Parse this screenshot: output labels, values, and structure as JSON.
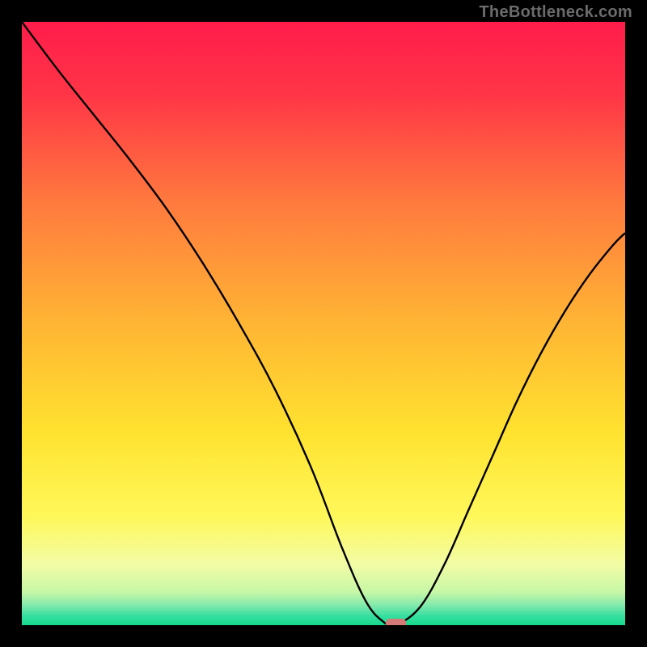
{
  "watermark": "TheBottleneck.com",
  "chart_data": {
    "type": "line",
    "title": "",
    "xlabel": "",
    "ylabel": "",
    "xlim": [
      0,
      100
    ],
    "ylim": [
      0,
      100
    ],
    "grid": false,
    "legend": false,
    "axes_visible": false,
    "background_gradient": {
      "stops": [
        {
          "offset": 0.0,
          "color": "#ff1c4b"
        },
        {
          "offset": 0.12,
          "color": "#ff3547"
        },
        {
          "offset": 0.3,
          "color": "#ff7a3e"
        },
        {
          "offset": 0.5,
          "color": "#ffb534"
        },
        {
          "offset": 0.68,
          "color": "#ffe22f"
        },
        {
          "offset": 0.82,
          "color": "#fff85a"
        },
        {
          "offset": 0.9,
          "color": "#f2fca6"
        },
        {
          "offset": 0.945,
          "color": "#c7f7a6"
        },
        {
          "offset": 0.965,
          "color": "#8aebad"
        },
        {
          "offset": 0.985,
          "color": "#35dfa0"
        },
        {
          "offset": 1.0,
          "color": "#17d98e"
        }
      ]
    },
    "series": [
      {
        "name": "bottleneck-curve",
        "color": "#000000",
        "x": [
          0,
          6,
          12,
          18,
          24,
          30,
          36,
          42,
          48,
          53,
          57,
          60,
          62,
          66,
          70,
          74,
          78,
          82,
          86,
          90,
          94,
          98,
          100
        ],
        "y": [
          100,
          92,
          84.5,
          77,
          69,
          60,
          50,
          39,
          26,
          13,
          4,
          0.5,
          0,
          3,
          10,
          19,
          28,
          37,
          45,
          52,
          58,
          63,
          65
        ]
      }
    ],
    "marker": {
      "name": "optimal-marker",
      "x": 62,
      "y": 0,
      "width_pct": 3.4,
      "height_pct": 1.6,
      "color": "#d47b78"
    }
  }
}
